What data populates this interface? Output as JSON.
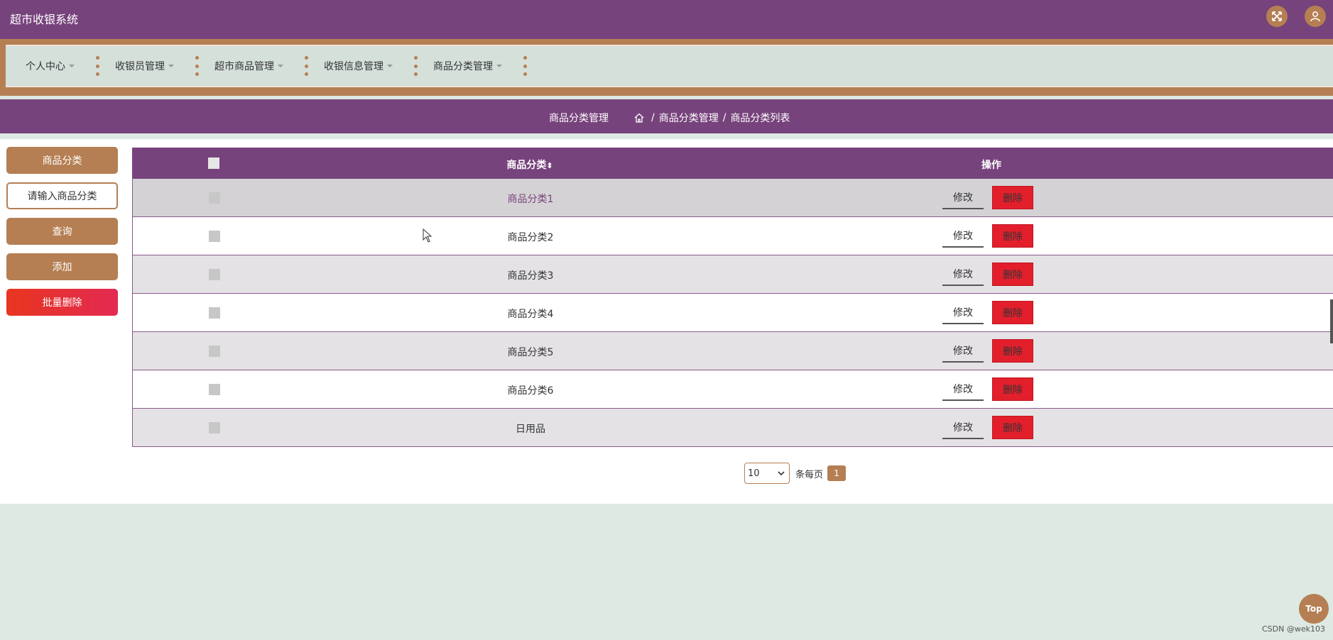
{
  "app": {
    "title": "超市收银系统"
  },
  "header_icons": [
    "fullscreen-icon",
    "user-icon"
  ],
  "nav": {
    "items": [
      {
        "label": "个人中心"
      },
      {
        "label": "收银员管理"
      },
      {
        "label": "超市商品管理"
      },
      {
        "label": "收银信息管理"
      },
      {
        "label": "商品分类管理"
      }
    ]
  },
  "breadcrumb": {
    "title": "商品分类管理",
    "path": [
      "商品分类管理",
      "商品分类列表"
    ],
    "separator": "/"
  },
  "sidebar": {
    "label_button": "商品分类",
    "search_placeholder": "请输入商品分类",
    "query_button": "查询",
    "add_button": "添加",
    "batch_delete_button": "批量删除"
  },
  "table": {
    "columns": {
      "name": "商品分类",
      "sort_icon": "⬍",
      "actions": "操作"
    },
    "rows": [
      {
        "name": "商品分类1"
      },
      {
        "name": "商品分类2"
      },
      {
        "name": "商品分类3"
      },
      {
        "name": "商品分类4"
      },
      {
        "name": "商品分类5"
      },
      {
        "name": "商品分类6"
      },
      {
        "name": "日用品"
      }
    ],
    "edit_label": "修改",
    "delete_label": "删除"
  },
  "pagination": {
    "page_size": "10",
    "per_page_label": "条每页",
    "current_page": "1"
  },
  "top_button": "Top",
  "watermark": "CSDN @wek103",
  "colors": {
    "primary": "#77437c",
    "accent": "#b57f53",
    "danger": "#e31f2c",
    "background": "#dde9e2"
  }
}
